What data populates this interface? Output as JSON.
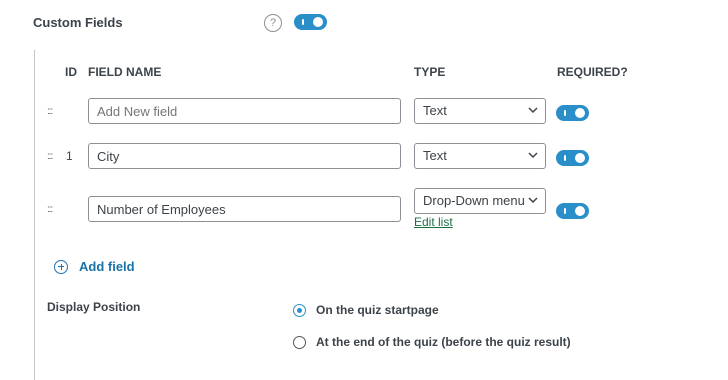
{
  "section": {
    "title": "Custom Fields",
    "help_icon": "?",
    "enabled": true
  },
  "table": {
    "headers": {
      "id": "ID",
      "field_name": "FIELD NAME",
      "type": "TYPE",
      "required": "REQUIRED?"
    },
    "drag_handle": ":::",
    "rows": [
      {
        "id": "",
        "field_value": "",
        "field_placeholder": "Add New field",
        "type": "Text",
        "required": true
      },
      {
        "id": "1",
        "field_value": "City",
        "field_placeholder": "",
        "type": "Text",
        "required": true
      },
      {
        "id": "",
        "field_value": "Number of Employees",
        "field_placeholder": "",
        "type": "Drop-Down menu",
        "required": true,
        "edit_link": "Edit list"
      }
    ]
  },
  "add_field_label": "Add field",
  "display_position": {
    "title": "Display Position",
    "options": [
      {
        "label": "On the quiz startpage",
        "selected": true
      },
      {
        "label": "At the end of the quiz (before the quiz result)",
        "selected": false
      }
    ]
  },
  "colors": {
    "accent": "#2a8fc9",
    "link": "#1a73a8",
    "edit_link": "#1d6f42"
  },
  "icons": {
    "help": "help-icon",
    "drag": "drag-handle-icon",
    "chevron": "chevron-down-icon",
    "add": "plus-circle-icon"
  }
}
